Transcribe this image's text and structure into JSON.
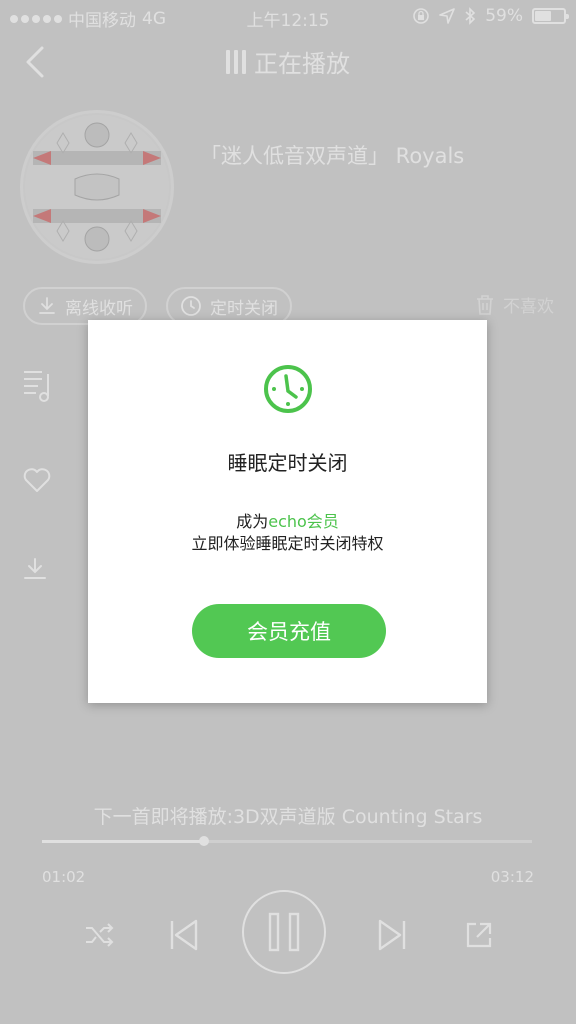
{
  "status_bar": {
    "carrier": "中国移动",
    "network": "4G",
    "time": "上午12:15",
    "battery": "59%",
    "battery_level": 0.59
  },
  "nav": {
    "title": "正在播放"
  },
  "song": {
    "title": "「迷人低音双声道」 Royals"
  },
  "actions": {
    "offline": "离线收听",
    "timer": "定时关闭",
    "dislike": "不喜欢"
  },
  "player": {
    "next_up": "下一首即将播放:3D双声道版 Counting Stars",
    "elapsed": "01:02",
    "duration": "03:12",
    "progress": 0.33
  },
  "modal": {
    "title": "睡眠定时关闭",
    "line1_prefix": "成为",
    "line1_highlight": "echo会员",
    "line2": "立即体验睡眠定时关闭特权",
    "button": "会员充值"
  },
  "colors": {
    "accent": "#52c853",
    "highlight": "#4cc34c"
  }
}
